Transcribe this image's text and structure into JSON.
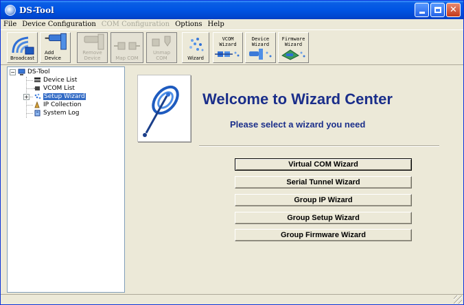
{
  "window": {
    "title": "DS-Tool"
  },
  "menu": [
    {
      "label": "File",
      "enabled": true
    },
    {
      "label": "Device Configuration",
      "enabled": true
    },
    {
      "label": "COM Configuration",
      "enabled": false
    },
    {
      "label": "Options",
      "enabled": true
    },
    {
      "label": "Help",
      "enabled": true
    }
  ],
  "toolbar": {
    "broadcast": "Broadcast",
    "add_device": [
      "Add",
      "Device"
    ],
    "remove_device": [
      "Remove",
      "Device"
    ],
    "map_com": "Map COM",
    "unmap_com": [
      "Unmap",
      "COM"
    ],
    "wizard": "Wizard",
    "vcom_wizard": [
      "VCOM",
      "Wizard"
    ],
    "device_wizard": [
      "Device",
      "Wizard"
    ],
    "firmware_wizard": [
      "Firmware",
      "Wizard"
    ]
  },
  "tree": {
    "root": "DS-Tool",
    "items": [
      {
        "label": "Device List",
        "icon": "device-list-icon"
      },
      {
        "label": "VCOM List",
        "icon": "vcom-list-icon"
      },
      {
        "label": "Setup Wizard",
        "icon": "setup-wizard-icon",
        "selected": true,
        "expandable": true
      },
      {
        "label": "IP Collection",
        "icon": "ip-collection-icon"
      },
      {
        "label": "System Log",
        "icon": "system-log-icon"
      }
    ]
  },
  "main": {
    "title": "Welcome to Wizard Center",
    "subtitle": "Please select a wizard you need",
    "buttons": [
      "Virtual COM Wizard",
      "Serial Tunnel Wizard",
      "Group IP Wizard",
      "Group Setup Wizard",
      "Group Firmware Wizard"
    ]
  },
  "colors": {
    "title_blue": "#1a2e8a",
    "selection": "#316ac5",
    "titlebar": "#0054e3"
  }
}
